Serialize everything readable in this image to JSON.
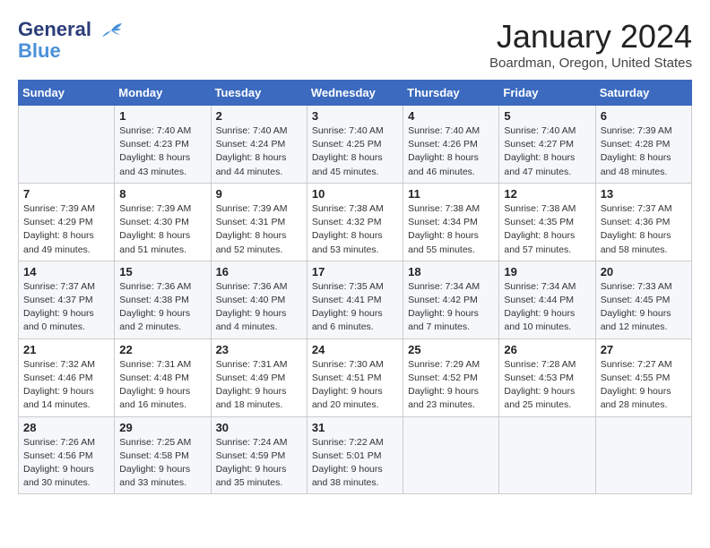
{
  "logo": {
    "line1": "General",
    "line2": "Blue"
  },
  "title": "January 2024",
  "subtitle": "Boardman, Oregon, United States",
  "days_of_week": [
    "Sunday",
    "Monday",
    "Tuesday",
    "Wednesday",
    "Thursday",
    "Friday",
    "Saturday"
  ],
  "weeks": [
    [
      {
        "day": "",
        "info": ""
      },
      {
        "day": "1",
        "info": "Sunrise: 7:40 AM\nSunset: 4:23 PM\nDaylight: 8 hours\nand 43 minutes."
      },
      {
        "day": "2",
        "info": "Sunrise: 7:40 AM\nSunset: 4:24 PM\nDaylight: 8 hours\nand 44 minutes."
      },
      {
        "day": "3",
        "info": "Sunrise: 7:40 AM\nSunset: 4:25 PM\nDaylight: 8 hours\nand 45 minutes."
      },
      {
        "day": "4",
        "info": "Sunrise: 7:40 AM\nSunset: 4:26 PM\nDaylight: 8 hours\nand 46 minutes."
      },
      {
        "day": "5",
        "info": "Sunrise: 7:40 AM\nSunset: 4:27 PM\nDaylight: 8 hours\nand 47 minutes."
      },
      {
        "day": "6",
        "info": "Sunrise: 7:39 AM\nSunset: 4:28 PM\nDaylight: 8 hours\nand 48 minutes."
      }
    ],
    [
      {
        "day": "7",
        "info": ""
      },
      {
        "day": "8",
        "info": "Sunrise: 7:39 AM\nSunset: 4:30 PM\nDaylight: 8 hours\nand 51 minutes."
      },
      {
        "day": "9",
        "info": "Sunrise: 7:39 AM\nSunset: 4:31 PM\nDaylight: 8 hours\nand 52 minutes."
      },
      {
        "day": "10",
        "info": "Sunrise: 7:38 AM\nSunset: 4:32 PM\nDaylight: 8 hours\nand 53 minutes."
      },
      {
        "day": "11",
        "info": "Sunrise: 7:38 AM\nSunset: 4:34 PM\nDaylight: 8 hours\nand 55 minutes."
      },
      {
        "day": "12",
        "info": "Sunrise: 7:38 AM\nSunset: 4:35 PM\nDaylight: 8 hours\nand 57 minutes."
      },
      {
        "day": "13",
        "info": "Sunrise: 7:37 AM\nSunset: 4:36 PM\nDaylight: 8 hours\nand 58 minutes."
      }
    ],
    [
      {
        "day": "14",
        "info": ""
      },
      {
        "day": "15",
        "info": "Sunrise: 7:36 AM\nSunset: 4:38 PM\nDaylight: 9 hours\nand 2 minutes."
      },
      {
        "day": "16",
        "info": "Sunrise: 7:36 AM\nSunset: 4:40 PM\nDaylight: 9 hours\nand 4 minutes."
      },
      {
        "day": "17",
        "info": "Sunrise: 7:35 AM\nSunset: 4:41 PM\nDaylight: 9 hours\nand 6 minutes."
      },
      {
        "day": "18",
        "info": "Sunrise: 7:34 AM\nSunset: 4:42 PM\nDaylight: 9 hours\nand 7 minutes."
      },
      {
        "day": "19",
        "info": "Sunrise: 7:34 AM\nSunset: 4:44 PM\nDaylight: 9 hours\nand 10 minutes."
      },
      {
        "day": "20",
        "info": "Sunrise: 7:33 AM\nSunset: 4:45 PM\nDaylight: 9 hours\nand 12 minutes."
      }
    ],
    [
      {
        "day": "21",
        "info": ""
      },
      {
        "day": "22",
        "info": "Sunrise: 7:31 AM\nSunset: 4:48 PM\nDaylight: 9 hours\nand 16 minutes."
      },
      {
        "day": "23",
        "info": "Sunrise: 7:31 AM\nSunset: 4:49 PM\nDaylight: 9 hours\nand 18 minutes."
      },
      {
        "day": "24",
        "info": "Sunrise: 7:30 AM\nSunset: 4:51 PM\nDaylight: 9 hours\nand 20 minutes."
      },
      {
        "day": "25",
        "info": "Sunrise: 7:29 AM\nSunset: 4:52 PM\nDaylight: 9 hours\nand 23 minutes."
      },
      {
        "day": "26",
        "info": "Sunrise: 7:28 AM\nSunset: 4:53 PM\nDaylight: 9 hours\nand 25 minutes."
      },
      {
        "day": "27",
        "info": "Sunrise: 7:27 AM\nSunset: 4:55 PM\nDaylight: 9 hours\nand 28 minutes."
      }
    ],
    [
      {
        "day": "28",
        "info": ""
      },
      {
        "day": "29",
        "info": "Sunrise: 7:25 AM\nSunset: 4:58 PM\nDaylight: 9 hours\nand 33 minutes."
      },
      {
        "day": "30",
        "info": "Sunrise: 7:24 AM\nSunset: 4:59 PM\nDaylight: 9 hours\nand 35 minutes."
      },
      {
        "day": "31",
        "info": "Sunrise: 7:22 AM\nSunset: 5:01 PM\nDaylight: 9 hours\nand 38 minutes."
      },
      {
        "day": "",
        "info": ""
      },
      {
        "day": "",
        "info": ""
      },
      {
        "day": "",
        "info": ""
      }
    ]
  ],
  "week_sunday_info": [
    {
      "day": "",
      "info": ""
    },
    {
      "day": "7",
      "sunrise": "Sunrise: 7:39 AM",
      "sunset": "Sunset: 4:29 PM",
      "daylight": "Daylight: 8 hours",
      "daylight2": "and 49 minutes."
    },
    {
      "day": "14",
      "sunrise": "Sunrise: 7:37 AM",
      "sunset": "Sunset: 4:37 PM",
      "daylight": "Daylight: 9 hours",
      "daylight2": "and 0 minutes."
    },
    {
      "day": "21",
      "sunrise": "Sunrise: 7:32 AM",
      "sunset": "Sunset: 4:46 PM",
      "daylight": "Daylight: 9 hours",
      "daylight2": "and 14 minutes."
    },
    {
      "day": "28",
      "sunrise": "Sunrise: 7:26 AM",
      "sunset": "Sunset: 4:56 PM",
      "daylight": "Daylight: 9 hours",
      "daylight2": "and 30 minutes."
    }
  ]
}
